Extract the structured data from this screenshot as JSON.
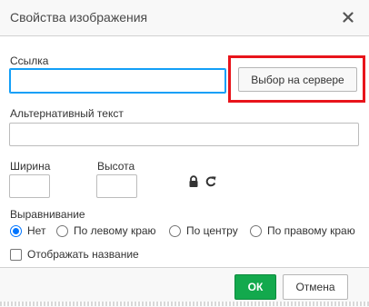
{
  "dialog": {
    "title": "Свойства изображения"
  },
  "form": {
    "url_label": "Ссылка",
    "url_value": "",
    "browse_server_label": "Выбор на сервере",
    "alt_label": "Альтернативный текст",
    "alt_value": "",
    "width_label": "Ширина",
    "width_value": "",
    "height_label": "Высота",
    "height_value": "",
    "alignment_label": "Выравнивание",
    "alignment_options": [
      {
        "label": "Нет",
        "checked": true
      },
      {
        "label": "По левому краю",
        "checked": false
      },
      {
        "label": "По центру",
        "checked": false
      },
      {
        "label": "По правому краю",
        "checked": false
      }
    ],
    "caption_label": "Отображать название",
    "caption_checked": false
  },
  "footer": {
    "ok_label": "ОК",
    "cancel_label": "Отмена"
  },
  "icons": {
    "close": "close-icon",
    "lock": "lock-icon",
    "reset": "reset-size-icon"
  },
  "colors": {
    "accent_focus": "#139ff7",
    "highlight": "#e8141b",
    "ok_button": "#13a94d",
    "radio_checked": "#0075ff"
  }
}
